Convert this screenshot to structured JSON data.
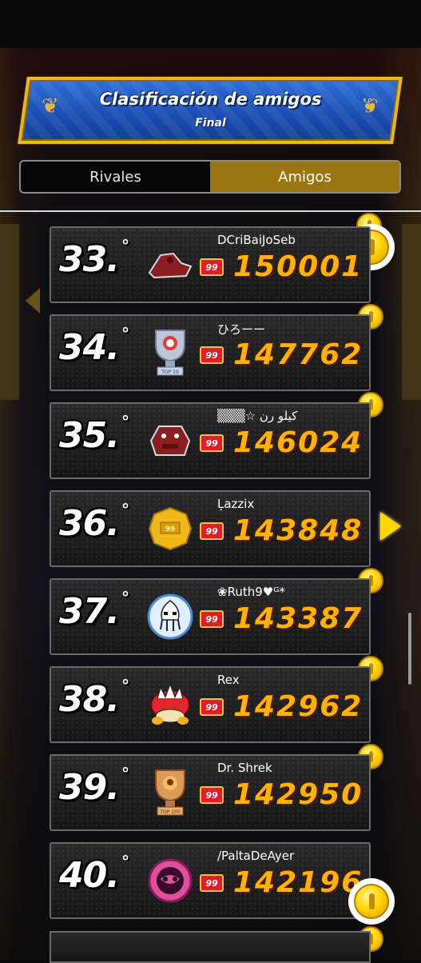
{
  "header": {
    "title": "Clasificación de amigos",
    "subtitle": "Final"
  },
  "tabs": [
    {
      "label": "Rivales",
      "active": false
    },
    {
      "label": "Amigos",
      "active": true
    }
  ],
  "colors": {
    "accent_gold": "#9a7410",
    "score_orange": "#ffb300",
    "banner_blue": "#1b4fb4"
  },
  "rows": [
    {
      "rank": "33.",
      "rank_sup": "°",
      "name": "DCriBaiJoSeb",
      "level": "99",
      "score": "150001",
      "avatar": "kong-icon"
    },
    {
      "rank": "34.",
      "rank_sup": "°",
      "name": "ひろーー",
      "level": "99",
      "score": "147762",
      "avatar": "trophy-top10-icon"
    },
    {
      "rank": "35.",
      "rank_sup": "°",
      "name": "▒▒▒☆ كيلو رن",
      "level": "99",
      "score": "146024",
      "avatar": "kong-icon"
    },
    {
      "rank": "36.",
      "rank_sup": "°",
      "name": "Ļazzix",
      "level": "99",
      "score": "143848",
      "avatar": "gold-badge-icon"
    },
    {
      "rank": "37.",
      "rank_sup": "°",
      "name": "❀Ruth9♥ᴳ*",
      "level": "99",
      "score": "143387",
      "avatar": "blooper-icon"
    },
    {
      "rank": "38.",
      "rank_sup": "°",
      "name": "Rex",
      "level": "99",
      "score": "142962",
      "avatar": "spiny-shell-icon"
    },
    {
      "rank": "39.",
      "rank_sup": "°",
      "name": "Dr. Shrek",
      "level": "99",
      "score": "142950",
      "avatar": "trophy-top100-icon"
    },
    {
      "rank": "40.",
      "rank_sup": "°",
      "name": "/PaltaDeAyer",
      "level": "99",
      "score": "142196",
      "avatar": "pink-emblem-icon"
    }
  ]
}
